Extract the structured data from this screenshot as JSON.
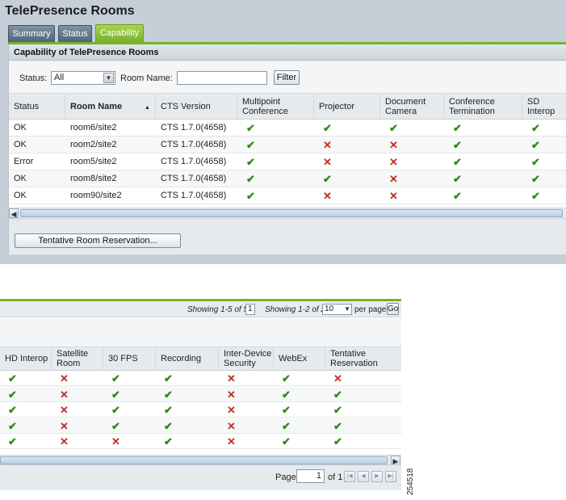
{
  "app": {
    "title": "TelePresence Rooms"
  },
  "tabs": [
    {
      "label": "Summary",
      "active": false
    },
    {
      "label": "Status",
      "active": false
    },
    {
      "label": "Capability",
      "active": true
    }
  ],
  "section": {
    "title": "Capability of TelePresence Rooms"
  },
  "filters": {
    "status_label": "Status:",
    "status_value": "All",
    "room_name_label": "Room Name:",
    "room_name_value": "",
    "filter_button": "Filter"
  },
  "top_table": {
    "columns": [
      "Status",
      "Room Name",
      "CTS Version",
      "Multipoint Conference",
      "Projector",
      "Document Camera",
      "Conference Termination",
      "SD Interop"
    ],
    "sort_column": "Room Name",
    "rows": [
      {
        "status": "OK",
        "room": "room6/site2",
        "version": "CTS 1.7.0(4658)",
        "caps": [
          true,
          true,
          true,
          true,
          true
        ]
      },
      {
        "status": "OK",
        "room": "room2/site2",
        "version": "CTS 1.7.0(4658)",
        "caps": [
          true,
          false,
          false,
          true,
          true
        ]
      },
      {
        "status": "Error",
        "room": "room5/site2",
        "version": "CTS 1.7.0(4658)",
        "caps": [
          true,
          false,
          false,
          true,
          true
        ]
      },
      {
        "status": "OK",
        "room": "room8/site2",
        "version": "CTS 1.7.0(4658)",
        "caps": [
          true,
          true,
          false,
          true,
          true
        ]
      },
      {
        "status": "OK",
        "room": "room90/site2",
        "version": "CTS 1.7.0(4658)",
        "caps": [
          true,
          false,
          false,
          true,
          true
        ]
      }
    ]
  },
  "reservation_button": "Tentative Room Reservation...",
  "paging_info": {
    "showing_items": "Showing 1-5 of 5",
    "items_box": "1",
    "showing_pages": "Showing 1-2 of 2",
    "per_page_value": "10",
    "per_page_label": "per page",
    "go_button": "Go"
  },
  "bottom_table": {
    "columns": [
      "HD Interop",
      "Satellite Room",
      "30 FPS",
      "Recording",
      "Inter-Device Security",
      "WebEx",
      "Tentative Reservation"
    ],
    "rows": [
      [
        true,
        false,
        true,
        true,
        false,
        true,
        false
      ],
      [
        true,
        false,
        true,
        true,
        false,
        true,
        true
      ],
      [
        true,
        false,
        true,
        true,
        false,
        true,
        true
      ],
      [
        true,
        false,
        true,
        true,
        false,
        true,
        true
      ],
      [
        true,
        false,
        false,
        true,
        false,
        true,
        true
      ]
    ]
  },
  "pager": {
    "page_label": "Page",
    "page_value": "1",
    "of_label": "of 1"
  },
  "figure_id": "254518",
  "icons": {
    "check": "check-icon",
    "cross": "cross-icon"
  },
  "colors": {
    "check": "#2f8a1d",
    "cross": "#c22a22",
    "active_tab": "#78b12b"
  }
}
